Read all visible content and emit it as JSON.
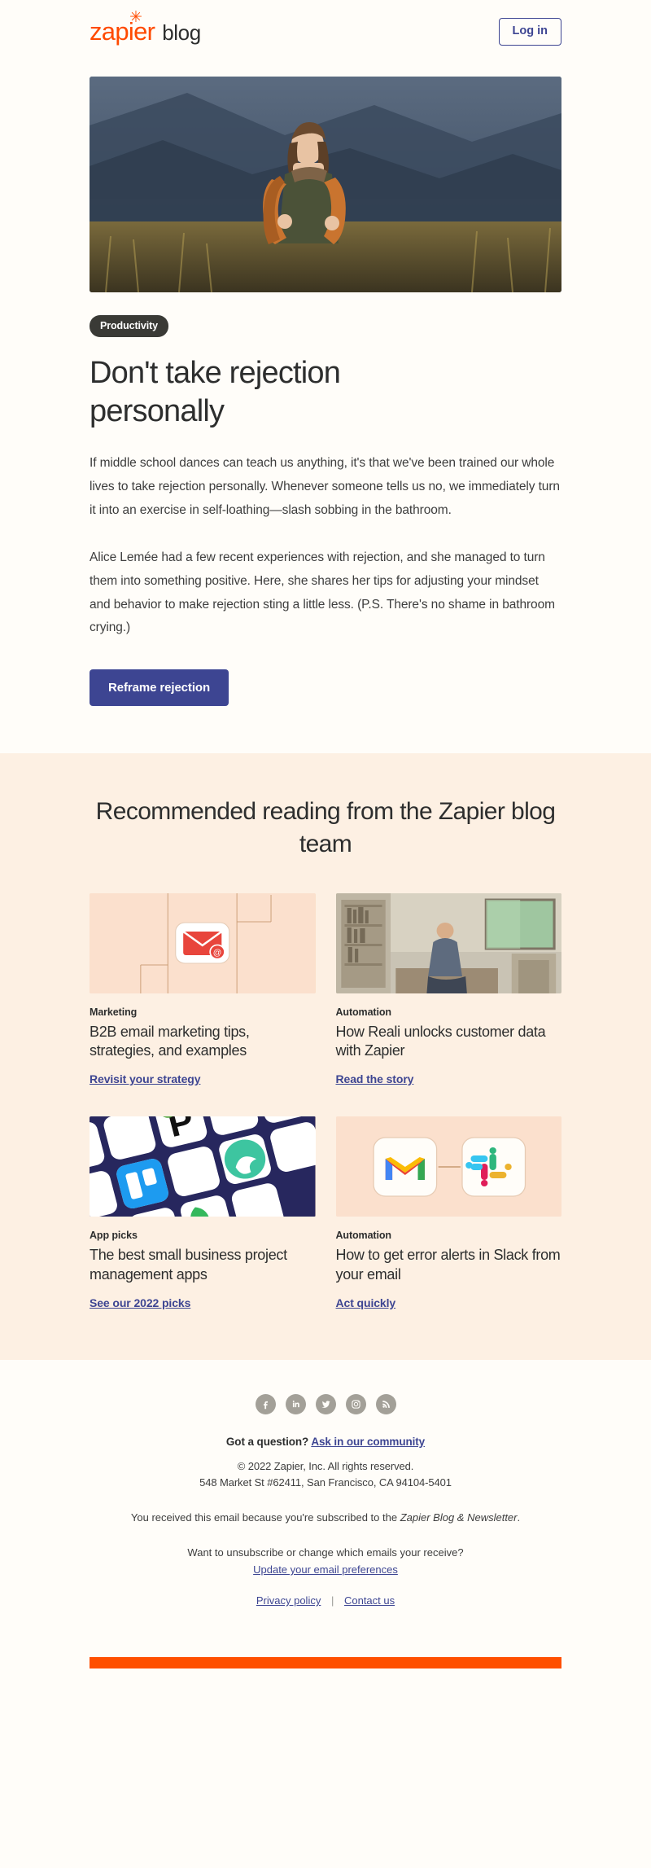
{
  "header": {
    "logo_word": "zapier",
    "logo_star": "✳",
    "logo_suffix": "blog",
    "login_label": "Log in"
  },
  "hero": {
    "image_alt": "hiker-with-backpack-photo"
  },
  "article": {
    "tag": "Productivity",
    "headline": "Don't take rejection personally",
    "paragraph_1": "If middle school dances can teach us anything, it's that we've been trained our whole lives to take rejection personally. Whenever someone tells us no, we immediately turn it into an exercise in self-loathing—slash sobbing in the bathroom.",
    "paragraph_2": "Alice Lemée had a few recent experiences with rejection, and she managed to turn them into something positive. Here, she shares her tips for adjusting your mindset and behavior to make rejection sting a little less. (P.S. There's no shame in bathroom crying.)",
    "cta_label": "Reframe rejection"
  },
  "recommended": {
    "title": "Recommended reading from the Zapier blog team",
    "cards": [
      {
        "image_alt": "email-envelope-illustration",
        "category": "Marketing",
        "title": "B2B email marketing tips, strategies, and examples",
        "link": "Revisit your strategy"
      },
      {
        "image_alt": "man-working-in-home-office-photo",
        "category": "Automation",
        "title": "How Reali unlocks customer data with Zapier",
        "link": "Read the story"
      },
      {
        "image_alt": "project-management-app-icons-collage",
        "category": "App picks",
        "title": "The best small business project management apps",
        "link": "See our 2022 picks"
      },
      {
        "image_alt": "gmail-to-slack-connection-illustration",
        "category": "Automation",
        "title": "How to get error alerts in Slack from your email",
        "link": "Act quickly"
      }
    ]
  },
  "footer": {
    "social": [
      {
        "name": "facebook-icon",
        "label": "Facebook"
      },
      {
        "name": "linkedin-icon",
        "label": "LinkedIn"
      },
      {
        "name": "twitter-icon",
        "label": "Twitter"
      },
      {
        "name": "instagram-icon",
        "label": "Instagram"
      },
      {
        "name": "rss-icon",
        "label": "RSS"
      }
    ],
    "question_text": "Got a question?",
    "question_link": "Ask in our community",
    "copyright": "© 2022 Zapier, Inc. All rights reserved.",
    "address": "548 Market St #62411, San Francisco, CA 94104-5401",
    "reason_prefix": "You received this email because you're subscribed to the ",
    "reason_italic": "Zapier Blog & Newsletter",
    "reason_suffix": ".",
    "unsub_text": "Want to unsubscribe or change which emails your receive?",
    "prefs_link": "Update your email preferences",
    "privacy_link": "Privacy policy",
    "separator": "|",
    "contact_link": "Contact us"
  },
  "colors": {
    "brand_orange": "#FF4A00",
    "bottom_bar_orange": "#FF4F00",
    "indigo": "#3D4592",
    "cream_bg": "#FFFDF9",
    "peach_bg": "#FDF0E3",
    "tag_dark": "#3A3A36"
  }
}
